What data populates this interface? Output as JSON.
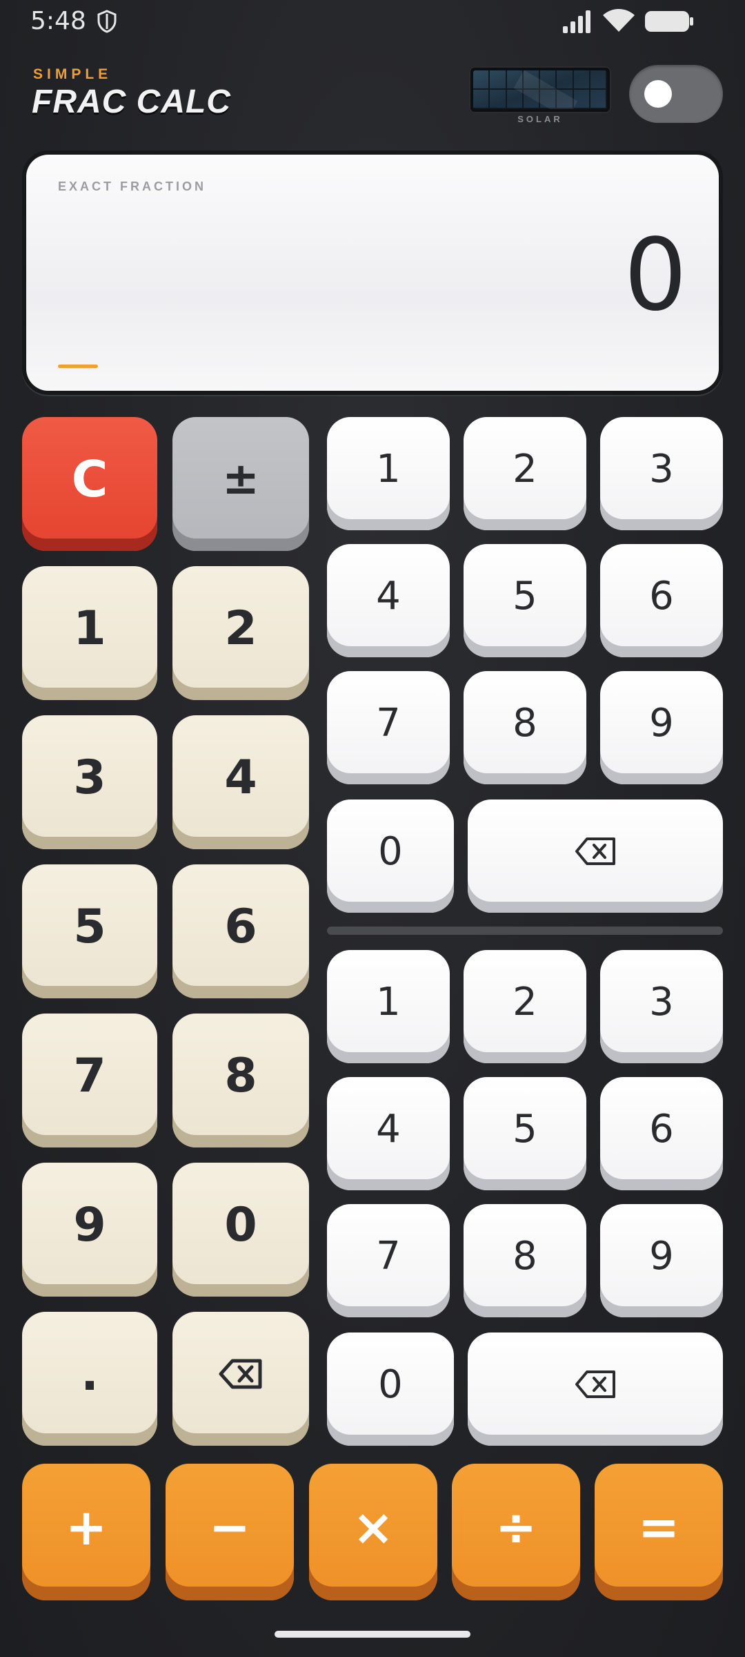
{
  "status_bar": {
    "time": "5:48"
  },
  "header": {
    "subtitle": "SIMPLE",
    "title": "FRAC CALC",
    "solar_label": "SOLAR"
  },
  "display": {
    "label": "EXACT FRACTION",
    "value": "0"
  },
  "control_keys": {
    "clear": "C",
    "sign": "±"
  },
  "whole_keys": [
    "1",
    "2",
    "3",
    "4",
    "5",
    "6",
    "7",
    "8",
    "9",
    "0",
    "."
  ],
  "numerator_keys": [
    "1",
    "2",
    "3",
    "4",
    "5",
    "6",
    "7",
    "8",
    "9",
    "0"
  ],
  "denominator_keys": [
    "1",
    "2",
    "3",
    "4",
    "5",
    "6",
    "7",
    "8",
    "9",
    "0"
  ],
  "operators": {
    "add": "+",
    "subtract": "−",
    "multiply": "×",
    "divide": "÷",
    "equals": "="
  },
  "icons": [
    "shield-icon",
    "signal-icon",
    "wifi-icon",
    "battery-icon",
    "backspace-icon"
  ],
  "colors": {
    "accent": "#f0a030",
    "clear": "#e4432f",
    "operator": "#ee9027",
    "background": "#222326"
  }
}
